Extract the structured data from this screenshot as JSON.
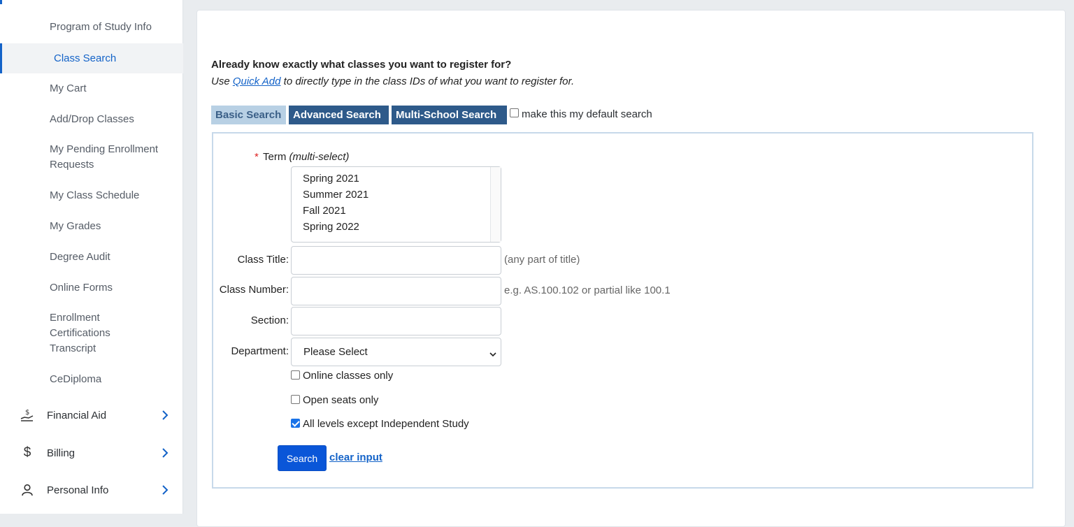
{
  "sidebar": {
    "sub_items": [
      {
        "label": "Program of Study Info",
        "active": false
      },
      {
        "label": "Class Search",
        "active": true
      },
      {
        "label": "My Cart",
        "active": false
      },
      {
        "label": "Add/Drop Classes",
        "active": false
      },
      {
        "label": "My Pending Enrollment Requests",
        "active": false
      },
      {
        "label": "My Class Schedule",
        "active": false
      },
      {
        "label": "My Grades",
        "active": false
      },
      {
        "label": "Degree Audit",
        "active": false
      },
      {
        "label": "Online Forms",
        "active": false
      },
      {
        "label": "Enrollment Certifications Transcript",
        "active": false
      },
      {
        "label": "CeDiploma",
        "active": false
      }
    ],
    "main_items": [
      {
        "label": "Financial Aid",
        "icon": "hand-coin-icon"
      },
      {
        "label": "Billing",
        "icon": "dollar-icon"
      },
      {
        "label": "Personal Info",
        "icon": "person-icon"
      }
    ]
  },
  "intro": {
    "heading": "Already know exactly what classes you want to register for?",
    "line_prefix": "Use ",
    "quick_add_link": "Quick Add",
    "line_suffix": " to directly type in the class IDs of what you want to register for."
  },
  "tabs": {
    "basic": "Basic Search",
    "advanced": "Advanced Search",
    "multi_school": "Multi-School Search",
    "default_checkbox_label": "make this my default search"
  },
  "form": {
    "term_label": "Term",
    "term_hint": "(multi-select)",
    "term_options": [
      "Spring 2021",
      "Summer 2021",
      "Fall 2021",
      "Spring 2022"
    ],
    "class_title_label": "Class Title:",
    "class_title_hint": "(any part of title)",
    "class_number_label": "Class Number:",
    "class_number_hint": "e.g. AS.100.102 or partial like 100.1",
    "section_label": "Section:",
    "department_label": "Department:",
    "department_value": "Please Select",
    "online_only_label": "Online classes only",
    "open_seats_label": "Open seats only",
    "all_levels_label": "All levels except Independent Study",
    "search_button": "Search",
    "clear_link": "clear input"
  },
  "colors": {
    "accent": "#1463c8",
    "tab_active_bg": "#b8d0e4",
    "tab_bg": "#2e5a8a",
    "button_bg": "#0a56d8"
  }
}
